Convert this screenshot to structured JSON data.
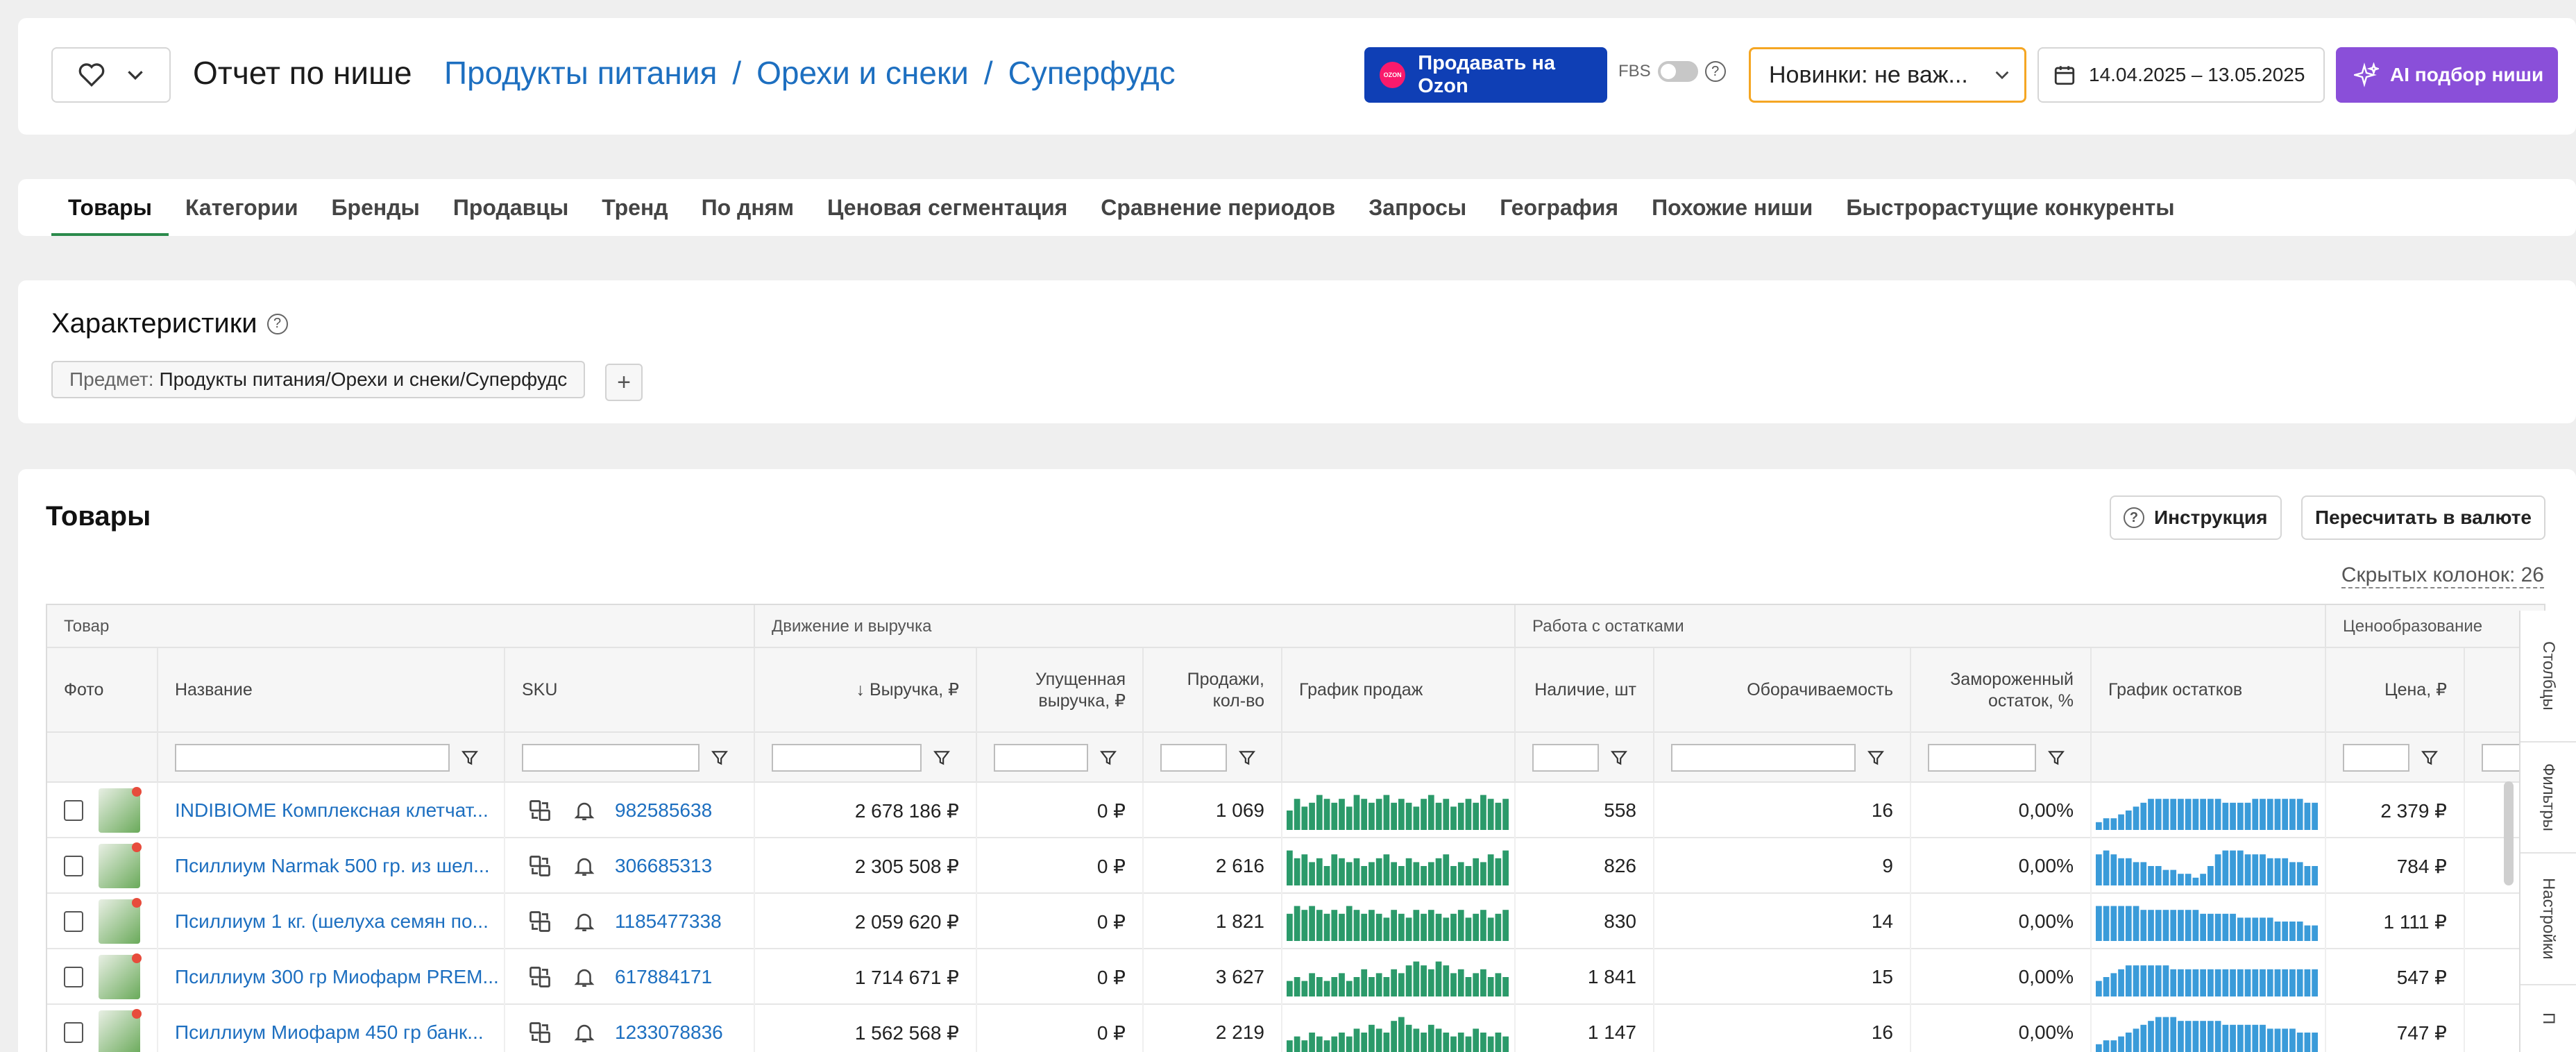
{
  "header": {
    "page_title": "Отчет по нише",
    "breadcrumbs": [
      "Продукты питания",
      "Орехи и снеки",
      "Суперфудс"
    ],
    "breadcrumb_separator": "/",
    "ozon_button": "Продавать на Ozon",
    "ozon_logo_text": "OZON",
    "fbs_label": "FBS",
    "novelty_select": "Новинки: не важ...",
    "date_range": "14.04.2025 – 13.05.2025",
    "ai_button": "AI подбор ниши"
  },
  "tabs": [
    "Товары",
    "Категории",
    "Бренды",
    "Продавцы",
    "Тренд",
    "По дням",
    "Ценовая сегментация",
    "Сравнение периодов",
    "Запросы",
    "География",
    "Похожие ниши",
    "Быстрорастущие конкуренты"
  ],
  "active_tab": 0,
  "characteristics": {
    "title": "Характеристики",
    "chip_label": "Предмет:",
    "chip_value": "Продукты питания/Орехи и снеки/Суперфудс",
    "add_label": "+"
  },
  "products": {
    "title": "Товары",
    "instruction_button": "Инструкция",
    "currency_button": "Пересчитать в валюте",
    "hidden_columns": "Скрытых колонок: 26",
    "groups": [
      "Товар",
      "Движение и выручка",
      "Работа с остатками",
      "Ценообразование"
    ],
    "columns": {
      "photo": "Фото",
      "name": "Название",
      "sku": "SKU",
      "revenue": "↓ Выручка, ₽",
      "lost_revenue": "Упущенная выручка, ₽",
      "sales": "Продажи, кол-во",
      "sales_chart": "График продаж",
      "stock": "Наличие, шт",
      "turnover": "Оборачиваемость",
      "frozen": "Замороженный остаток, %",
      "stock_chart": "График остатков",
      "price": "Цена, ₽"
    },
    "rows": [
      {
        "name": "INDIBIOME Комплексная клетчат...",
        "sku": "982585638",
        "revenue": "2 678 186 ₽",
        "lost_revenue": "0 ₽",
        "sales": "1 069",
        "stock": "558",
        "turnover": "16",
        "frozen": "0,00%",
        "price": "2 379 ₽",
        "sales_series": [
          5,
          8,
          6,
          7,
          9,
          8,
          7,
          8,
          6,
          9,
          8,
          7,
          8,
          9,
          7,
          8,
          7,
          6,
          8,
          9,
          7,
          8,
          6,
          7,
          8,
          7,
          9,
          8,
          7,
          8
        ],
        "stock_series": [
          2,
          3,
          3,
          4,
          5,
          6,
          7,
          8,
          8,
          8,
          8,
          8,
          8,
          8,
          8,
          8,
          8,
          7,
          7,
          7,
          7,
          8,
          8,
          8,
          8,
          8,
          8,
          8,
          7,
          7
        ]
      },
      {
        "name": "Псиллиум Narmak 500 гр. из шел...",
        "sku": "306685313",
        "revenue": "2 305 508 ₽",
        "lost_revenue": "0 ₽",
        "sales": "2 616",
        "stock": "826",
        "turnover": "9",
        "frozen": "0,00%",
        "price": "784 ₽",
        "sales_series": [
          9,
          7,
          8,
          6,
          7,
          5,
          8,
          7,
          6,
          7,
          5,
          6,
          7,
          8,
          6,
          5,
          7,
          6,
          5,
          6,
          7,
          8,
          5,
          6,
          5,
          7,
          6,
          8,
          7,
          9
        ],
        "stock_series": [
          8,
          9,
          8,
          7,
          7,
          6,
          6,
          5,
          5,
          4,
          4,
          3,
          3,
          2,
          3,
          5,
          8,
          9,
          9,
          9,
          8,
          8,
          8,
          7,
          7,
          7,
          6,
          6,
          5,
          5
        ]
      },
      {
        "name": "Псиллиум 1 кг. (шелуха семян по...",
        "sku": "1185477338",
        "revenue": "2 059 620 ₽",
        "lost_revenue": "0 ₽",
        "sales": "1 821",
        "stock": "830",
        "turnover": "14",
        "frozen": "0,00%",
        "price": "1 111 ₽",
        "sales_series": [
          7,
          9,
          8,
          9,
          8,
          7,
          8,
          7,
          9,
          8,
          7,
          8,
          7,
          6,
          8,
          7,
          6,
          8,
          7,
          8,
          7,
          6,
          7,
          8,
          6,
          7,
          8,
          6,
          7,
          8
        ],
        "stock_series": [
          9,
          9,
          9,
          9,
          9,
          9,
          8,
          8,
          8,
          8,
          8,
          8,
          8,
          8,
          7,
          7,
          7,
          7,
          7,
          6,
          6,
          6,
          6,
          6,
          5,
          5,
          5,
          5,
          4,
          4
        ]
      },
      {
        "name": "Псиллиум 300 гр Миофарм PREM...",
        "sku": "617884171",
        "revenue": "1 714 671 ₽",
        "lost_revenue": "0 ₽",
        "sales": "3 627",
        "stock": "1 841",
        "turnover": "15",
        "frozen": "0,00%",
        "price": "547 ₽",
        "sales_series": [
          4,
          5,
          4,
          6,
          5,
          4,
          5,
          6,
          4,
          5,
          7,
          5,
          6,
          5,
          7,
          6,
          8,
          9,
          8,
          7,
          9,
          8,
          6,
          7,
          5,
          6,
          7,
          5,
          6,
          5
        ],
        "stock_series": [
          4,
          5,
          6,
          7,
          8,
          8,
          8,
          8,
          8,
          8,
          7,
          7,
          7,
          7,
          7,
          7,
          7,
          7,
          7,
          7,
          7,
          7,
          7,
          7,
          7,
          7,
          7,
          7,
          7,
          7
        ]
      },
      {
        "name": "Псиллиум Миофарм 450 гр банк...",
        "sku": "1233078836",
        "revenue": "1 562 568 ₽",
        "lost_revenue": "0 ₽",
        "sales": "2 219",
        "stock": "1 147",
        "turnover": "16",
        "frozen": "0,00%",
        "price": "747 ₽",
        "sales_series": [
          3,
          4,
          3,
          5,
          4,
          3,
          4,
          5,
          4,
          6,
          5,
          7,
          6,
          5,
          8,
          9,
          7,
          6,
          5,
          7,
          6,
          5,
          4,
          5,
          4,
          6,
          5,
          4,
          5,
          4
        ],
        "stock_series": [
          2,
          3,
          3,
          4,
          5,
          6,
          7,
          8,
          9,
          9,
          9,
          8,
          8,
          8,
          8,
          8,
          8,
          7,
          7,
          7,
          7,
          7,
          7,
          6,
          6,
          6,
          6,
          5,
          5,
          5
        ]
      }
    ]
  },
  "side_panel": [
    "Столбцы",
    "Фильтры",
    "Настройки",
    "П"
  ],
  "colors": {
    "accent_green": "#2b9a6a",
    "accent_blue": "#3a9bd9",
    "link": "#1d6fc0",
    "ozon_blue": "#0f3fb5",
    "ai_purple": "#8a4fd9",
    "select_orange": "#f5a623"
  }
}
